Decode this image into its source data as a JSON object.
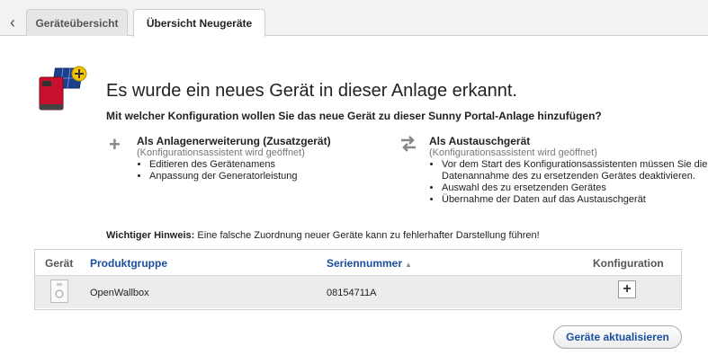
{
  "tabs": [
    {
      "label": "Geräteübersicht"
    },
    {
      "label": "Übersicht Neugeräte"
    }
  ],
  "headline": "Es wurde ein neues Gerät in dieser Anlage erkannt.",
  "question": "Mit welcher Konfiguration wollen Sie das neue Gerät zu dieser Sunny Portal-Anlage hinzufügen?",
  "options": {
    "extension": {
      "icon": "plus-icon",
      "title": "Als Anlagenerweiterung (Zusatzgerät)",
      "subtitle": "(Konfigurationsassistent wird geöffnet)",
      "bullets": [
        "Editieren des Gerätenamens",
        "Anpassung der Generatorleistung"
      ]
    },
    "replacement": {
      "icon": "swap-arrows-icon",
      "title": "Als Austauschgerät",
      "subtitle": "(Konfigurationsassistent wird geöffnet)",
      "bullets": [
        "Vor dem Start des Konfigurationsassistenten müssen Sie die Datenannahme des zu ersetzenden Gerätes deaktivieren.",
        "Auswahl des zu ersetzenden Gerätes",
        "Übernahme der Daten auf das Austauschgerät"
      ]
    }
  },
  "note": {
    "label": "Wichtiger Hinweis:",
    "text": " Eine falsche Zuordnung neuer Geräte kann zu fehlerhafter Darstellung führen!"
  },
  "table": {
    "columns": [
      "Gerät",
      "Produktgruppe",
      "Seriennummer",
      "Konfiguration"
    ],
    "rows": [
      {
        "product_group": "OpenWallbox",
        "serial": "08154711A"
      }
    ]
  },
  "refresh_button": "Geräte aktualisieren",
  "colors": {
    "link": "#1a4fa0",
    "row_bg": "#ececec",
    "accent_red": "#c8102e"
  }
}
